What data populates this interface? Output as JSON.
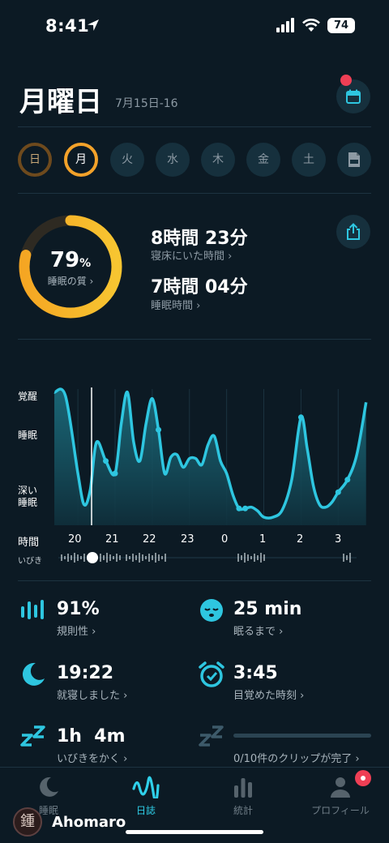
{
  "status": {
    "time": "8:41",
    "battery": "74"
  },
  "header": {
    "day": "月曜日",
    "date_range": "7月15日-16"
  },
  "week": [
    "日",
    "月",
    "火",
    "水",
    "木",
    "金",
    "土"
  ],
  "summary": {
    "score": "79",
    "score_unit": "%",
    "score_label": "睡眠の質 ›",
    "time_in_bed": "8時間 23分",
    "time_in_bed_label": "寝床にいた時間 ›",
    "time_asleep": "7時間 04分",
    "time_asleep_label": "睡眠時間 ›"
  },
  "chart_data": {
    "type": "area",
    "y_levels": [
      "覚醒",
      "睡眠",
      "深い\n睡眠"
    ],
    "x_label": "時間",
    "x_ticks": [
      "20",
      "21",
      "22",
      "23",
      "0",
      "1",
      "2",
      "3"
    ],
    "snore_label": "いびき",
    "x": [
      "19:22",
      "19:40",
      "20:00",
      "20:10",
      "20:20",
      "20:30",
      "20:45",
      "21:00",
      "21:10",
      "21:20",
      "21:30",
      "21:40",
      "21:50",
      "22:00",
      "22:10",
      "22:20",
      "22:30",
      "22:40",
      "22:50",
      "23:00",
      "23:10",
      "23:20",
      "23:30",
      "23:40",
      "23:50",
      "0:00",
      "0:10",
      "0:20",
      "0:30",
      "0:40",
      "0:50",
      "1:00",
      "1:15",
      "1:30",
      "1:45",
      "2:00",
      "2:10",
      "2:20",
      "2:30",
      "2:40",
      "2:50",
      "3:00",
      "3:15",
      "3:30",
      "3:45"
    ],
    "depth": [
      1.0,
      0.97,
      0.35,
      0.1,
      0.22,
      0.6,
      0.45,
      0.35,
      0.75,
      1.0,
      0.6,
      0.45,
      0.75,
      0.95,
      0.7,
      0.35,
      0.48,
      0.5,
      0.4,
      0.47,
      0.47,
      0.42,
      0.58,
      0.65,
      0.45,
      0.35,
      0.18,
      0.07,
      0.07,
      0.08,
      0.05,
      0.0,
      0.0,
      0.06,
      0.3,
      0.8,
      0.55,
      0.25,
      0.1,
      0.08,
      0.12,
      0.2,
      0.3,
      0.5,
      0.92
    ],
    "accent_color": "#2ec6e0"
  },
  "metrics": {
    "regularity": {
      "value": "91%",
      "label": "規則性 ›",
      "icon": "bars-icon"
    },
    "fall_asleep": {
      "value": "25 min",
      "label": "眠るまで ›",
      "icon": "sleepy-face-icon"
    },
    "bedtime": {
      "value": "19:22",
      "label": "就寝しました ›",
      "icon": "moon-icon"
    },
    "wake_time": {
      "value": "3:45",
      "label": "目覚めた時刻 ›",
      "icon": "alarm-clock-icon"
    },
    "snoring": {
      "value": "1h  4m",
      "label": "いびきをかく ›",
      "icon": "zzz-icon"
    },
    "clips": {
      "value": "",
      "label": "0/10件のクリップが完了 ›",
      "icon": "zzz-icon"
    }
  },
  "tabs": [
    {
      "label": "睡眠",
      "icon": "moon-icon"
    },
    {
      "label": "日誌",
      "icon": "waveform-icon"
    },
    {
      "label": "統計",
      "icon": "bar-chart-icon"
    },
    {
      "label": "プロフィール",
      "icon": "person-icon"
    }
  ],
  "watermark": {
    "logo_text": "鍾",
    "text": "Ahomaro"
  }
}
